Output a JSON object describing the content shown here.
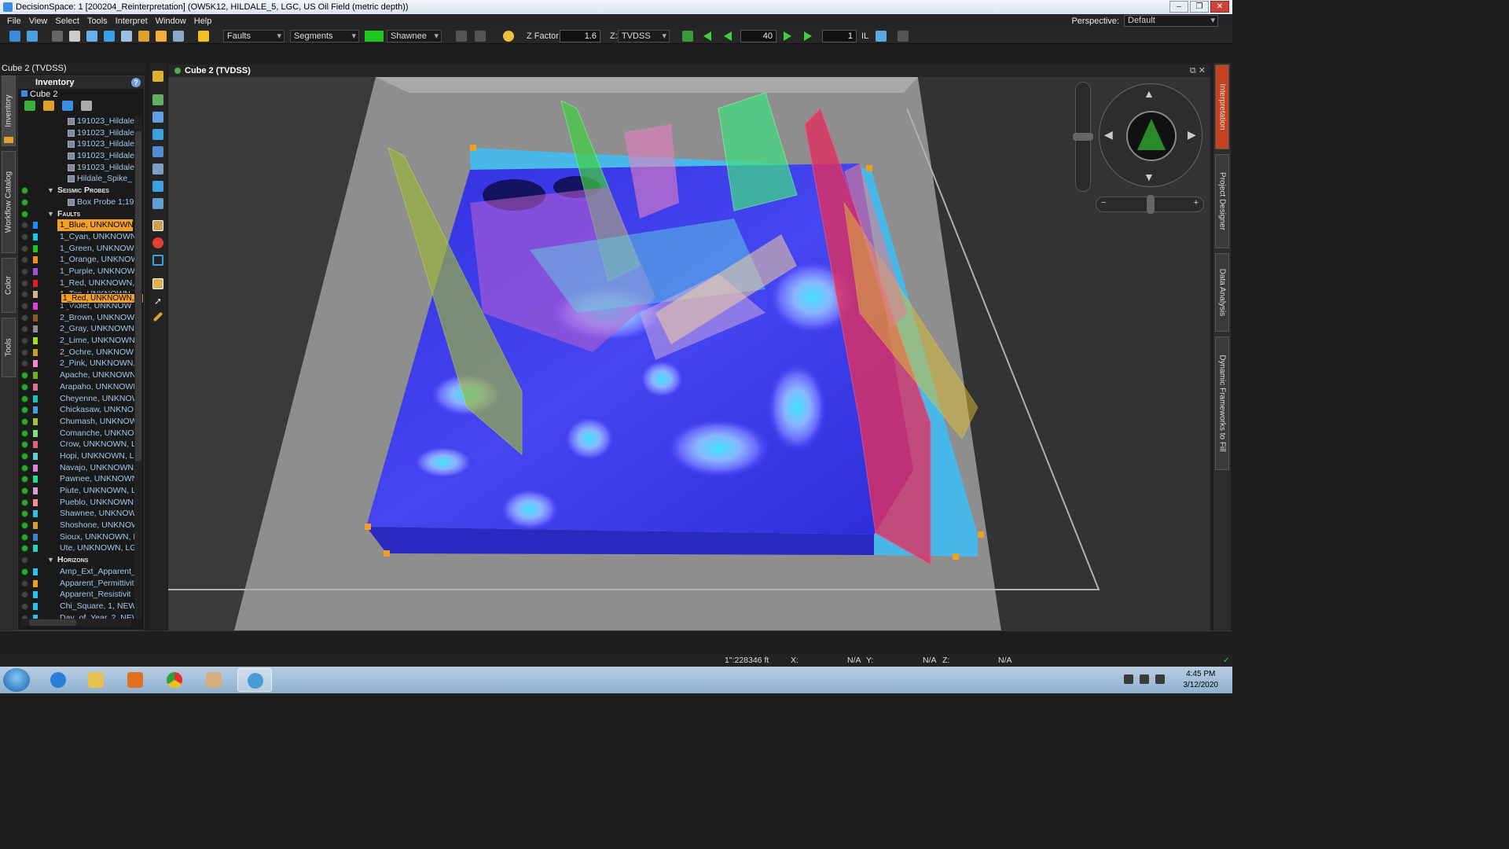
{
  "title_bar": {
    "text": "DecisionSpace: 1 [200204_Reinterpretation] (OW5K12, HILDALE_5, LGC, US Oil Field (metric depth))"
  },
  "menu": {
    "file": "File",
    "view": "View",
    "select": "Select",
    "tools": "Tools",
    "interpret": "Interpret",
    "window": "Window",
    "help": "Help"
  },
  "perspective": {
    "label": "Perspective:",
    "value": "Default"
  },
  "toolbar": {
    "object_type": "Faults",
    "display_mode": "Segments",
    "active_fault": "Shawnee",
    "active_fault_color": "#1ec81e",
    "zfactor_label": "Z Factor:",
    "zfactor_value": "1.6",
    "z_label": "Z:",
    "z_domain": "TVDSS",
    "step_value": "40",
    "line_value": "1",
    "line_type": "IL"
  },
  "panel": {
    "window_title": "Cube 2 (TVDSS)",
    "header": "Inventory",
    "root": "Cube 2",
    "files": [
      "191023_Hildale",
      "191023_Hildale",
      "191023_Hildale",
      "191023_Hildale",
      "191023_Hildale",
      "Hildale_Spike_"
    ],
    "seismic_probes_label": "Seismic Probes",
    "probes": [
      "Box Probe 1;1910"
    ],
    "faults_label": "Faults",
    "faults": [
      {
        "label": "1_Blue, UNKNOWN",
        "color": "#1a8cff",
        "on": false,
        "selected": true
      },
      {
        "label": "1_Cyan, UNKNOWN",
        "color": "#18c8e8",
        "on": false
      },
      {
        "label": "1_Green, UNKNOWN",
        "color": "#1ec81e",
        "on": false
      },
      {
        "label": "1_Orange, UNKNOW",
        "color": "#ff8c1a",
        "on": false
      },
      {
        "label": "1_Purple, UNKNOW",
        "color": "#a050e0",
        "on": false
      },
      {
        "label": "1_Red, UNKNOWN,",
        "color": "#e02020",
        "on": false
      },
      {
        "label": "1_Tan, UNKNOWN",
        "color": "#d2b48c",
        "on": false
      },
      {
        "label": "1_Violet, UNKNOW",
        "color": "#e040e0",
        "on": false
      },
      {
        "label": "2_Brown, UNKNOW",
        "color": "#8b5a2b",
        "on": false
      },
      {
        "label": "2_Gray, UNKNOWN",
        "color": "#909090",
        "on": false
      },
      {
        "label": "2_Lime, UNKNOWN",
        "color": "#9ce01e",
        "on": false
      },
      {
        "label": "2_Ochre, UNKNOW",
        "color": "#c8a020",
        "on": false
      },
      {
        "label": "2_Pink, UNKNOWN,",
        "color": "#ff88cc",
        "on": false
      },
      {
        "label": "Apache, UNKNOWN",
        "color": "#6ab020",
        "on": true
      },
      {
        "label": "Arapaho, UNKNOWN",
        "color": "#e07090",
        "on": true
      },
      {
        "label": "Cheyenne, UNKNOW",
        "color": "#20c0c0",
        "on": true
      },
      {
        "label": "Chickasaw, UNKNO",
        "color": "#40a0e0",
        "on": true
      },
      {
        "label": "Chumash, UNKNOW",
        "color": "#a0c040",
        "on": true
      },
      {
        "label": "Comanche, UNKNO",
        "color": "#80e080",
        "on": true
      },
      {
        "label": "Crow, UNKNOWN, L",
        "color": "#e06080",
        "on": true
      },
      {
        "label": "Hopi, UNKNOWN, L",
        "color": "#60d0d0",
        "on": true
      },
      {
        "label": "Navajo, UNKNOWN,",
        "color": "#e080e0",
        "on": true
      },
      {
        "label": "Pawnee, UNKNOWN",
        "color": "#20e090",
        "on": true
      },
      {
        "label": "Piute, UNKNOWN, L",
        "color": "#d0a0d0",
        "on": true
      },
      {
        "label": "Pueblo, UNKNOWN",
        "color": "#f09090",
        "on": true
      },
      {
        "label": "Shawnee, UNKNOW",
        "color": "#30c0e0",
        "on": true
      },
      {
        "label": "Shoshone, UNKNOW",
        "color": "#d0a040",
        "on": true
      },
      {
        "label": "Sioux, UNKNOWN, L",
        "color": "#4080d0",
        "on": true
      },
      {
        "label": "Ute, UNKNOWN, LG",
        "color": "#30d0c0",
        "on": true
      }
    ],
    "tooltip": "1_Red, UNKNOWN, LGC",
    "horizons_label": "Horizons",
    "horizons": [
      {
        "label": "Amp_Ext_Apparent_",
        "color": "#30c0f0",
        "on": true
      },
      {
        "label": "Apparent_Permittivit",
        "color": "#f0a020",
        "on": false
      },
      {
        "label": "Apparent_Resistivit",
        "color": "#30c0f0",
        "on": false
      },
      {
        "label": "Chi_Square, 1, NEW",
        "color": "#30c0f0",
        "on": false
      },
      {
        "label": "Day_of_Year, 2, NEW",
        "color": "#30c0f0",
        "on": false
      }
    ]
  },
  "left_tabs": [
    "Inventory",
    "Workflow Catalog",
    "Color",
    "Tools"
  ],
  "right_tabs": [
    "Interpretation",
    "Project Designer",
    "Data Analysis",
    "Dynamic Frameworks to Fill"
  ],
  "viewer": {
    "title": "Cube 2 (TVDSS)"
  },
  "status": {
    "scale": "1\":228346 ft",
    "x_label": "X:",
    "x_value": "N/A",
    "y_label": "Y:",
    "y_value": "N/A",
    "z_label": "Z:",
    "z_value": "N/A"
  },
  "taskbar": {
    "time": "4:45 PM",
    "date": "3/12/2020"
  },
  "colors": {
    "accent": "#f0a02a",
    "panel_bg": "#1a1a1a",
    "toolbar_bg": "#262626"
  }
}
